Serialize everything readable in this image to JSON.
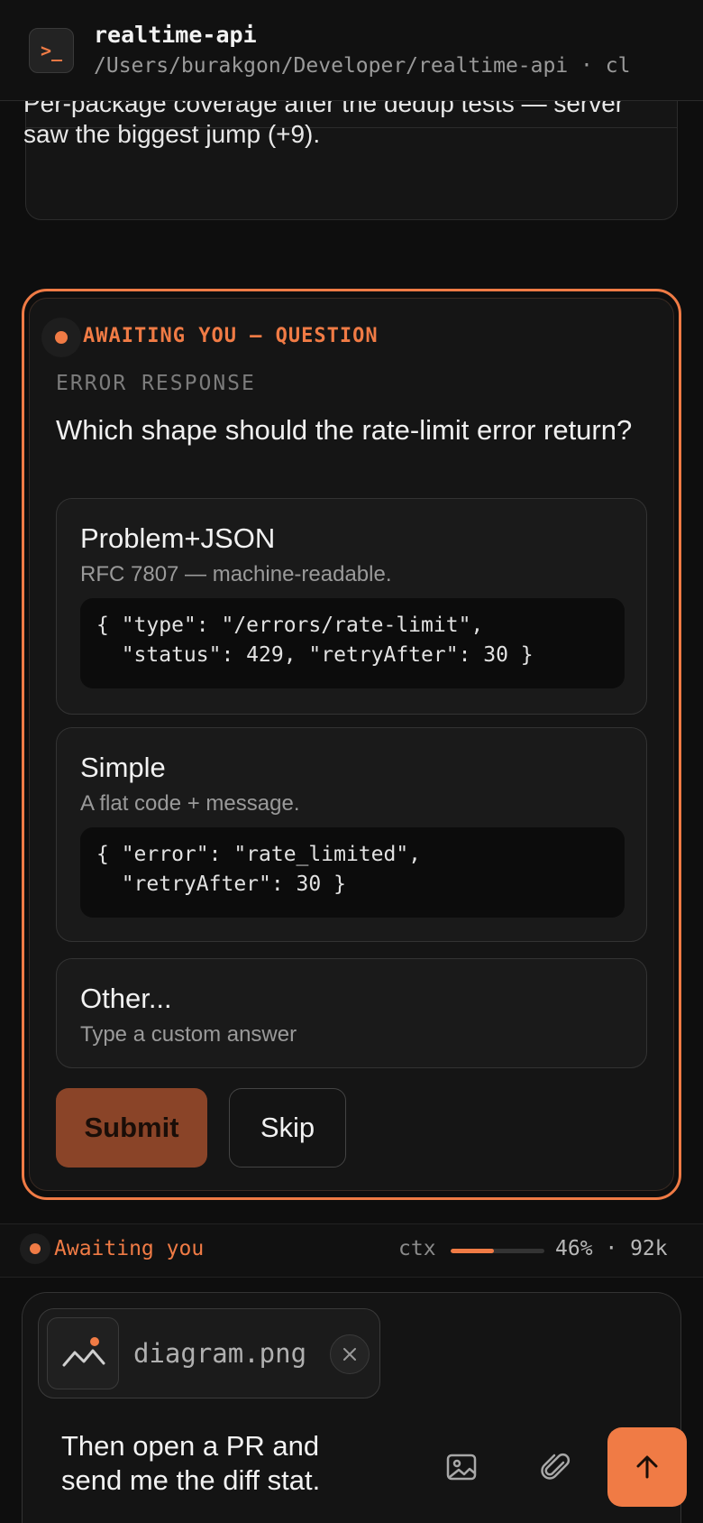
{
  "header": {
    "icon": "terminal-icon",
    "icon_glyph": ">_",
    "title": "realtime-api",
    "subtitle": "/Users/burakgon/Developer/realtime-api · cl"
  },
  "previous_card": {
    "caption": "Per-package coverage after the dedup tests — server saw the biggest jump (+9)."
  },
  "question": {
    "status": "AWAITING YOU — QUESTION",
    "section": "ERROR RESPONSE",
    "text": "Which shape should the rate-limit error return?",
    "options": [
      {
        "title": "Problem+JSON",
        "description": "RFC 7807 — machine-readable.",
        "code": "{ \"type\": \"/errors/rate-limit\",\n  \"status\": 429, \"retryAfter\": 30 }"
      },
      {
        "title": "Simple",
        "description": "A flat code + message.",
        "code": "{ \"error\": \"rate_limited\",\n  \"retryAfter\": 30 }"
      },
      {
        "title": "Other...",
        "description": "Type a custom answer"
      }
    ],
    "submit_label": "Submit",
    "skip_label": "Skip"
  },
  "statusbar": {
    "label": "Awaiting you",
    "ctx_label": "ctx",
    "ctx_percent": 46,
    "ctx_value": "46% · 92k"
  },
  "composer": {
    "attachment": {
      "name": "diagram.png",
      "icon": "image-icon"
    },
    "text": "Then open a PR and send me the diff stat.",
    "icons": [
      "image-icon",
      "paperclip-icon",
      "arrow-up-icon"
    ]
  },
  "colors": {
    "accent": "#f07b45",
    "background": "#0e0e0e",
    "submit_bg": "#8a4428"
  }
}
